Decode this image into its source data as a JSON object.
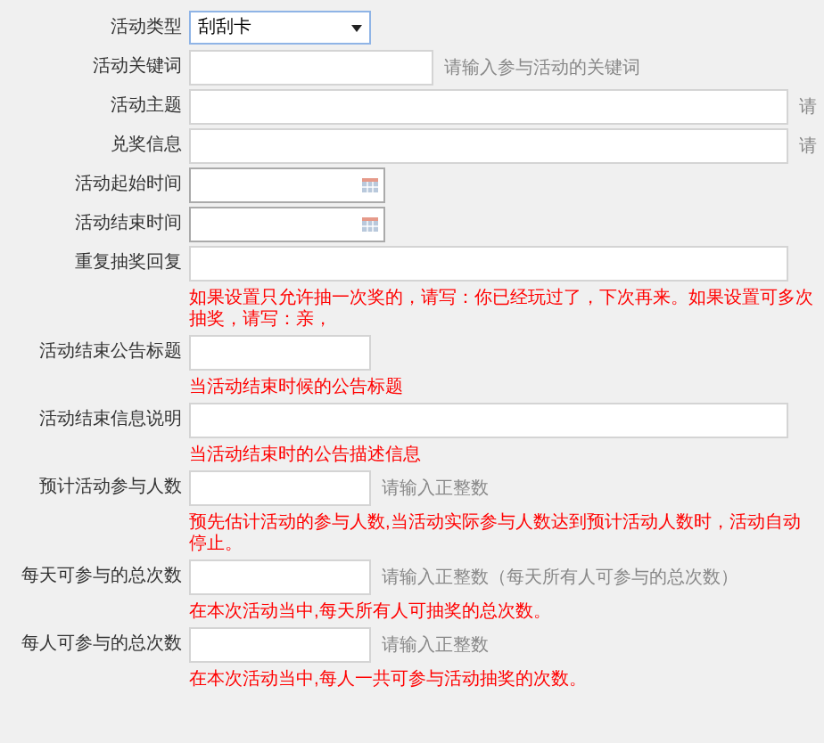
{
  "fields": [
    {
      "kind": "select",
      "label": "活动类型",
      "value": "刮刮卡"
    },
    {
      "kind": "keyword",
      "label": "活动关键词",
      "hint": "请输入参与活动的关键词"
    },
    {
      "kind": "wide",
      "label": "活动主题",
      "hint": "请"
    },
    {
      "kind": "wide",
      "label": "兑奖信息",
      "hint": "请"
    },
    {
      "kind": "date",
      "label": "活动起始时间"
    },
    {
      "kind": "date",
      "label": "活动结束时间"
    },
    {
      "kind": "wide",
      "label": "重复抽奖回复",
      "note": "如果设置只允许抽一次奖的，请写：你已经玩过了，下次再来。如果设置可多次抽奖，请写：亲，"
    },
    {
      "kind": "short",
      "label": "活动结束公告标题",
      "note": "当活动结束时候的公告标题"
    },
    {
      "kind": "wide",
      "label": "活动结束信息说明",
      "note": "当活动结束时的公告描述信息"
    },
    {
      "kind": "short",
      "label": "预计活动参与人数",
      "hint": "请输入正整数",
      "note": "预先估计活动的参与人数,当活动实际参与人数达到预计活动人数时，活动自动停止。"
    },
    {
      "kind": "short",
      "label": "每天可参与的总次数",
      "hint": "请输入正整数（每天所有人可参与的总次数）",
      "note": "在本次活动当中,每天所有人可抽奖的总次数。"
    },
    {
      "kind": "short",
      "label": "每人可参与的总次数",
      "hint": "请输入正整数",
      "note": "在本次活动当中,每人一共可参与活动抽奖的次数。"
    }
  ]
}
